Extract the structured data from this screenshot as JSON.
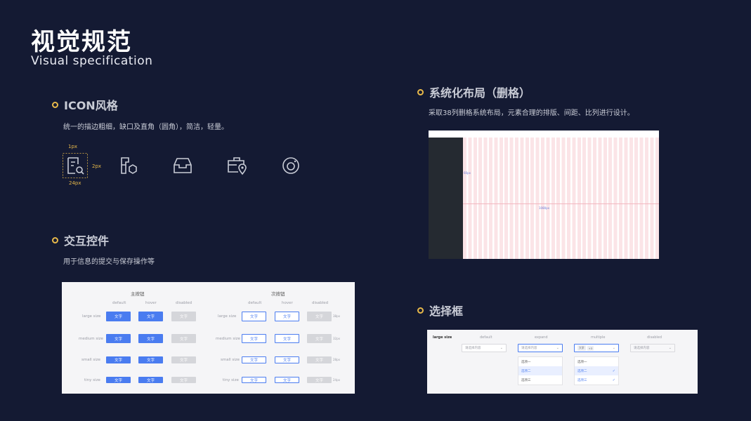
{
  "page": {
    "title": "视觉规范",
    "subtitle": "Visual specification"
  },
  "icon_section": {
    "title": "ICON风格",
    "description": "统一的描边粗细，缺口及直角（圆角），简洁，轻量。",
    "spec_stroke": "1px",
    "spec_gap": "2px",
    "spec_size": "24px",
    "icons": [
      "document-search-icon",
      "puzzle-hexagon-icon",
      "inbox-tray-icon",
      "briefcase-location-icon",
      "camera-lens-icon"
    ],
    "accent_color": "#e8b94a"
  },
  "grid_section": {
    "title": "系统化布局（删格）",
    "description": "采取38列删格系统布局，元素合理的排版、间距、比列进行设计。",
    "left_label": "60px",
    "center_label": "1080px"
  },
  "controls_section": {
    "title": "交互控件",
    "description": "用于信息的提交与保存操作等",
    "primary_heading": "主按钮",
    "secondary_heading": "次按钮",
    "states": [
      "default",
      "hover",
      "disabled"
    ],
    "sizes": [
      "large size",
      "medium size",
      "small size",
      "tiny size"
    ],
    "heights": [
      "38px",
      "32px",
      "28px",
      "24px"
    ],
    "button_text": "文字",
    "primary_color": "#4a7cf0"
  },
  "select_section": {
    "title": "选择框",
    "row_label": "large size",
    "columns": [
      "default",
      "expand",
      "multiple",
      "disabled"
    ],
    "placeholder": "请选择内容",
    "options": [
      "选项一",
      "选项二",
      "选项三"
    ],
    "tags": [
      "大学",
      "+3"
    ]
  }
}
